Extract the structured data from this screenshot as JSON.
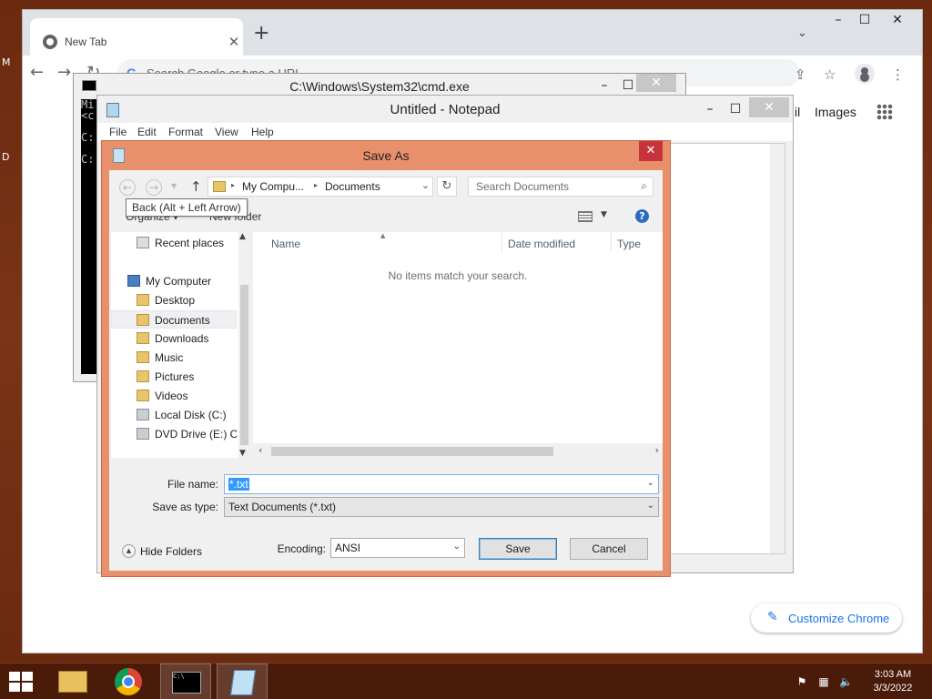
{
  "chrome": {
    "tab_title": "New Tab",
    "tab_close": "✕",
    "new_tab": "+",
    "tab_search": "⌄",
    "win_min": "–",
    "win_max": "☐",
    "win_close": "✕",
    "nav_back": "←",
    "nav_forward": "→",
    "nav_reload": "↻",
    "g_logo": "G",
    "omnibox_placeholder": "Search Google or type a URL",
    "share": "⇪",
    "bookmark": "☆",
    "menu": "⋮",
    "gmail_partial": "il",
    "images_link": "Images",
    "customize_label": "Customize Chrome",
    "customize_icon": "✎"
  },
  "cmd": {
    "title": "C:\\Windows\\System32\\cmd.exe",
    "icon_text": "C:\\",
    "lines": [
      "Mi",
      "<c",
      "",
      "C:",
      "",
      "C:"
    ],
    "controls": {
      "min": "–",
      "max": "☐",
      "close": "✕"
    }
  },
  "notepad": {
    "title": "Untitled - Notepad",
    "menu": [
      "File",
      "Edit",
      "Format",
      "View",
      "Help"
    ],
    "controls": {
      "min": "–",
      "max": "☐",
      "close": "✕"
    }
  },
  "save_as": {
    "title": "Save As",
    "close": "✕",
    "back": "←",
    "forward": "→",
    "recent_dropdown": "▼",
    "up": "↑",
    "address": [
      "My Compu...",
      "Documents"
    ],
    "address_sep": "▸",
    "address_dropdown": "⌄",
    "refresh": "↻",
    "search_placeholder": "Search Documents",
    "search_icon": "⌕",
    "tooltip": "Back (Alt + Left Arrow)",
    "organize": "Organize ▾",
    "new_folder": "New folder",
    "views_dropdown": "▼",
    "help": "?",
    "nav_items": [
      {
        "label": "Recent places",
        "icon": "recent-places-icon"
      },
      {
        "label": "My Computer",
        "icon": "computer-icon"
      },
      {
        "label": "Desktop",
        "icon": "folder-icon"
      },
      {
        "label": "Documents",
        "icon": "folder-icon",
        "selected": true
      },
      {
        "label": "Downloads",
        "icon": "downloads-folder-icon"
      },
      {
        "label": "Music",
        "icon": "music-folder-icon"
      },
      {
        "label": "Pictures",
        "icon": "pictures-folder-icon"
      },
      {
        "label": "Videos",
        "icon": "videos-folder-icon"
      },
      {
        "label": "Local Disk (C:)",
        "icon": "disk-icon"
      },
      {
        "label": "DVD Drive (E:) CD",
        "icon": "dvd-drive-icon"
      }
    ],
    "scroll_up": "▲",
    "scroll_down": "▼",
    "columns": [
      "Name",
      "Date modified",
      "Type"
    ],
    "sort_indicator": "▲",
    "empty_message": "No items match your search.",
    "hscroll_left": "‹",
    "hscroll_right": "›",
    "file_name_label": "File name:",
    "file_name_value": "*.txt",
    "save_type_label": "Save as type:",
    "save_type_value": "Text Documents (*.txt)",
    "dropdown_arrow": "⌄",
    "hide_folders_icon": "▲",
    "hide_folders": "Hide Folders",
    "encoding_label": "Encoding:",
    "encoding_value": "ANSI",
    "save_button": "Save",
    "cancel_button": "Cancel"
  },
  "taskbar": {
    "tray_flag": "⚑",
    "tray_network": "▦",
    "tray_volume": "🔈",
    "time": "3:03 AM",
    "date": "3/3/2022"
  }
}
